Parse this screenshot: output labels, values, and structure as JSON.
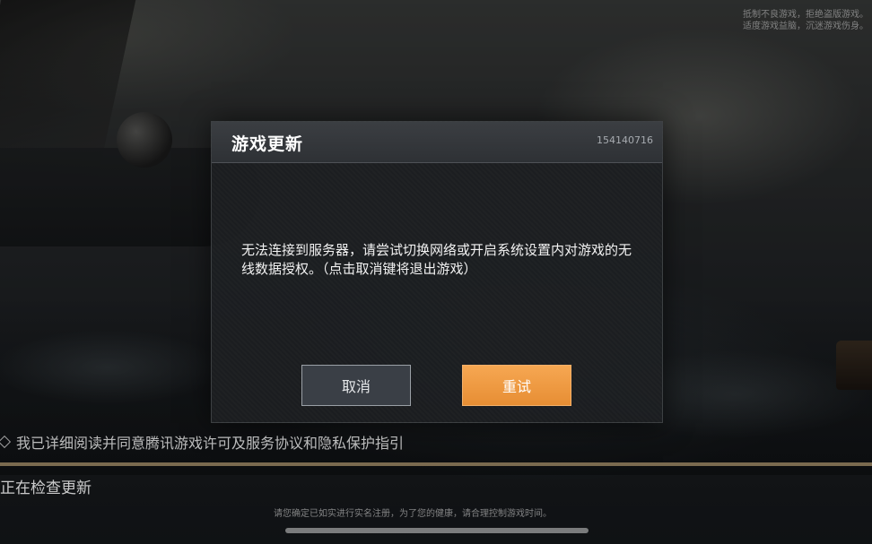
{
  "corner_notice": {
    "line1": "抵制不良游戏，拒绝盗版游戏。",
    "line2": "适度游戏益脑，沉迷游戏伤身。"
  },
  "dialog": {
    "title": "游戏更新",
    "code": "154140716",
    "message": "无法连接到服务器，请尝试切换网络或开启系统设置内对游戏的无线数据授权。（点击取消键将退出游戏）",
    "cancel_label": "取消",
    "retry_label": "重试"
  },
  "agreement": {
    "text": "我已详细阅读并同意腾讯游戏许可及服务协议和隐私保护指引"
  },
  "status": {
    "checking_text": "正在检查更新"
  },
  "health_notice": {
    "text": "请您确定已如实进行实名注册，为了您的健康，请合理控制游戏时间。"
  },
  "colors": {
    "retry_accent": "#f09a45",
    "dialog_bg": "#1c1e21",
    "cancel_bg": "#3a3f46"
  }
}
